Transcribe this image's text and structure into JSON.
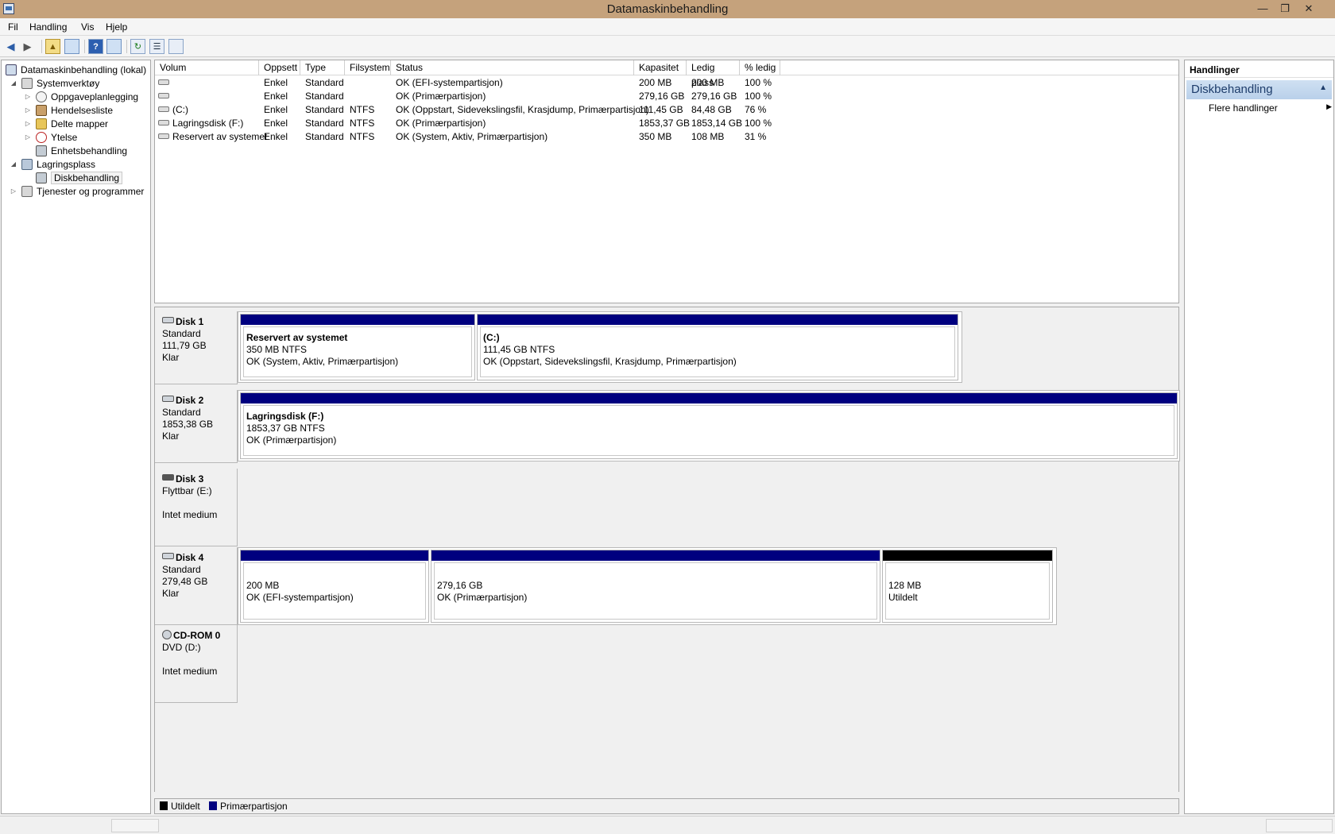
{
  "window": {
    "title": "Datamaskinbehandling",
    "minimize_glyph": "—",
    "restore_glyph": "❐",
    "close_glyph": "✕"
  },
  "menu": [
    "Fil",
    "Handling",
    "Vis",
    "Hjelp"
  ],
  "toolbar": {
    "back_glyph": "◀",
    "forward_glyph": "▶",
    "up_glyph": "▲",
    "help_glyph": "?",
    "refresh_glyph": "↻",
    "props_glyph": "☰",
    "icons": [
      "back-arrow-icon",
      "forward-arrow-icon",
      "up-folder-icon",
      "show-hide-tree-icon",
      "help-icon",
      "show-hide-action-pane-icon",
      "refresh-icon",
      "properties-icon",
      "settings-icon"
    ]
  },
  "tree": {
    "root": "Datamaskinbehandling (lokal)",
    "system_tools": "Systemverktøy",
    "task_scheduler": "Oppgaveplanlegging",
    "event_viewer": "Hendelsesliste",
    "shared_folders": "Delte mapper",
    "performance": "Ytelse",
    "device_manager": "Enhetsbehandling",
    "storage": "Lagringsplass",
    "disk_management": "Diskbehandling",
    "services": "Tjenester og programmer"
  },
  "volumes": {
    "headers": {
      "volum": "Volum",
      "oppsett": "Oppsett",
      "type": "Type",
      "filsystem": "Filsystem",
      "status": "Status",
      "kapasitet": "Kapasitet",
      "ledig": "Ledig plass",
      "pct": "% ledig"
    },
    "rows": [
      {
        "volum": "",
        "oppsett": "Enkel",
        "type": "Standard",
        "fs": "",
        "status": "OK (EFI-systempartisjon)",
        "kap": "200 MB",
        "ledig": "200 MB",
        "pct": "100 %"
      },
      {
        "volum": "",
        "oppsett": "Enkel",
        "type": "Standard",
        "fs": "",
        "status": "OK (Primærpartisjon)",
        "kap": "279,16 GB",
        "ledig": "279,16 GB",
        "pct": "100 %"
      },
      {
        "volum": "(C:)",
        "oppsett": "Enkel",
        "type": "Standard",
        "fs": "NTFS",
        "status": "OK (Oppstart, Sidevekslingsfil, Krasjdump, Primærpartisjon)",
        "kap": "111,45 GB",
        "ledig": "84,48 GB",
        "pct": "76 %"
      },
      {
        "volum": "Lagringsdisk (F:)",
        "oppsett": "Enkel",
        "type": "Standard",
        "fs": "NTFS",
        "status": "OK (Primærpartisjon)",
        "kap": "1853,37 GB",
        "ledig": "1853,14 GB",
        "pct": "100 %"
      },
      {
        "volum": "Reservert av systemet",
        "oppsett": "Enkel",
        "type": "Standard",
        "fs": "NTFS",
        "status": "OK (System, Aktiv, Primærpartisjon)",
        "kap": "350 MB",
        "ledig": "108 MB",
        "pct": "31 %"
      }
    ]
  },
  "disks": {
    "disk1": {
      "name": "Disk 1",
      "type": "Standard",
      "size": "111,79 GB",
      "state": "Klar",
      "parts": [
        {
          "name": "Reservert av systemet",
          "size": "350 MB NTFS",
          "status": "OK (System, Aktiv, Primærpartisjon)"
        },
        {
          "name": "(C:)",
          "size": "111,45 GB NTFS",
          "status": "OK (Oppstart, Sidevekslingsfil, Krasjdump, Primærpartisjon)"
        }
      ]
    },
    "disk2": {
      "name": "Disk 2",
      "type": "Standard",
      "size": "1853,38 GB",
      "state": "Klar",
      "parts": [
        {
          "name": "Lagringsdisk  (F:)",
          "size": "1853,37 GB NTFS",
          "status": "OK (Primærpartisjon)"
        }
      ]
    },
    "disk3": {
      "name": "Disk 3",
      "type": "Flyttbar (E:)",
      "state": "Intet medium"
    },
    "disk4": {
      "name": "Disk 4",
      "type": "Standard",
      "size": "279,48 GB",
      "state": "Klar",
      "parts": [
        {
          "size": "200 MB",
          "status": "OK (EFI-systempartisjon)"
        },
        {
          "size": "279,16 GB",
          "status": "OK (Primærpartisjon)"
        },
        {
          "size": "128 MB",
          "status": "Utildelt"
        }
      ]
    },
    "cdrom0": {
      "name": "CD-ROM 0",
      "type": "DVD (D:)",
      "state": "Intet medium"
    }
  },
  "legend": {
    "unallocated": "Utildelt",
    "primary": "Primærpartisjon",
    "unallocated_color": "#000000",
    "primary_color": "#00007f"
  },
  "actions": {
    "header": "Handlinger",
    "section": "Diskbehandling",
    "more": "Flere handlinger"
  }
}
